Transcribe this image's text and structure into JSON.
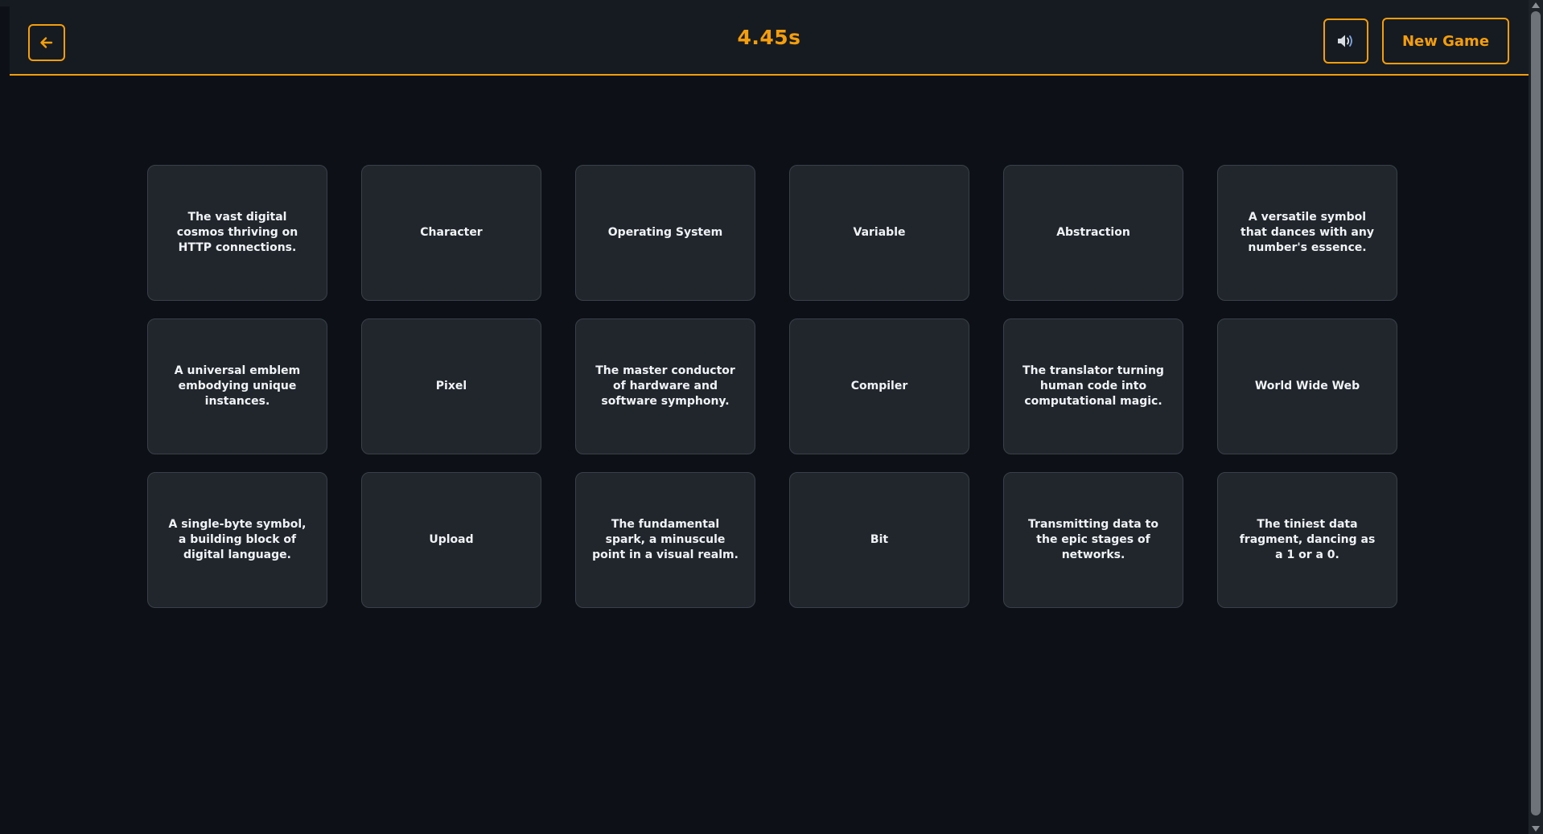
{
  "header": {
    "timer": "4.45s",
    "new_game_label": "New Game"
  },
  "icons": {
    "back": "arrow-left-icon",
    "sound": "speaker-icon"
  },
  "colors": {
    "accent": "#f59e0b",
    "background": "#0d1117",
    "header_bg": "#161b22",
    "card_bg": "#21262d",
    "card_text": "#f0f3f6"
  },
  "cards": [
    {
      "text": "The vast digital cosmos thriving on HTTP connections."
    },
    {
      "text": "Character"
    },
    {
      "text": "Operating System"
    },
    {
      "text": "Variable"
    },
    {
      "text": "Abstraction"
    },
    {
      "text": "A versatile symbol that dances with any number's essence."
    },
    {
      "text": "A universal emblem embodying unique instances."
    },
    {
      "text": "Pixel"
    },
    {
      "text": "The master conductor of hardware and software symphony."
    },
    {
      "text": "Compiler"
    },
    {
      "text": "The translator turning human code into computational magic."
    },
    {
      "text": "World Wide Web"
    },
    {
      "text": "A single-byte symbol, a building block of digital language."
    },
    {
      "text": "Upload"
    },
    {
      "text": "The fundamental spark, a minuscule point in a visual realm."
    },
    {
      "text": "Bit"
    },
    {
      "text": "Transmitting data to the epic stages of networks."
    },
    {
      "text": "The tiniest data fragment, dancing as a 1 or a 0."
    }
  ]
}
